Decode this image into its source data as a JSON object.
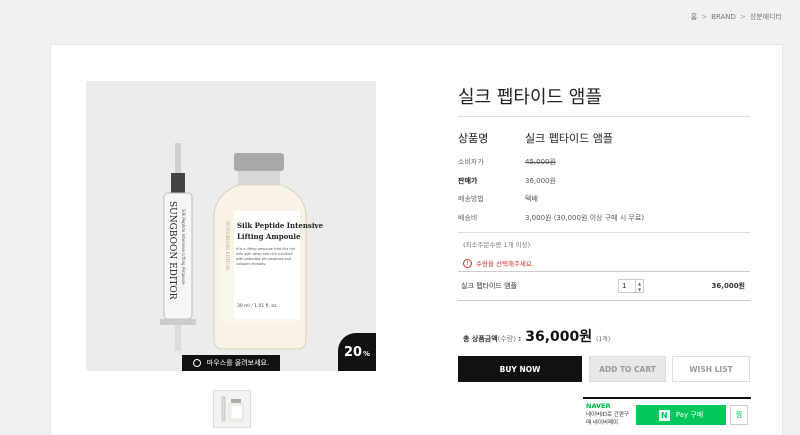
{
  "breadcrumb": {
    "home": "홈",
    "brand": "BRAND",
    "category": "성분에디터",
    "separator": ">"
  },
  "product": {
    "title": "실크 펩타이드 앰플",
    "name_label": "상품명",
    "name_value": "실크 펩타이드 앰플",
    "badge_value": "20",
    "badge_unit": "%",
    "zoom_hint": "마우스를 올려보세요.",
    "image_text": {
      "bottle_line1": "Silk Peptide Intensive",
      "bottle_line2": "Lifting Ampoule",
      "bottle_desc": "It is a lifting ampoule that fills the skin with deep and rich nutrition with patented silk peptides and collagen threads.",
      "bottle_volume": "30 ml / 1.01 fl. oz.",
      "brand_vertical": "SUNGBOON EDITOR",
      "syringe_vertical": "Silk Peptide Intensive Lifting Ampoule"
    }
  },
  "specs": [
    {
      "label": "소비자가",
      "value": "45,000원"
    },
    {
      "label": "판매가",
      "value": "36,000원"
    },
    {
      "label": "배송방법",
      "value": "택배"
    },
    {
      "label": "배송비",
      "value": "3,000원 (30,000원 이상 구매 시 무료)"
    }
  ],
  "min_order": "(최소주문수량 1개 이상)",
  "warning": {
    "icon": "!",
    "text": "수량을 선택해주세요."
  },
  "option": {
    "name": "실크 펩타이드 앰플",
    "quantity": "1",
    "price": "36,000원"
  },
  "total": {
    "label": "총 상품금액",
    "label_sub": "(수량)",
    "price": "36,000원",
    "qty": "(1개)"
  },
  "buttons": {
    "buy": "BUY NOW",
    "cart": "ADD TO CART",
    "wish": "WISH LIST"
  },
  "naver": {
    "logo": "NAVER",
    "sub": "네이버ID로 간편구매 네이버페이",
    "pay_label": "Pay 구매",
    "pay_box": "N",
    "zzim": "찜"
  }
}
